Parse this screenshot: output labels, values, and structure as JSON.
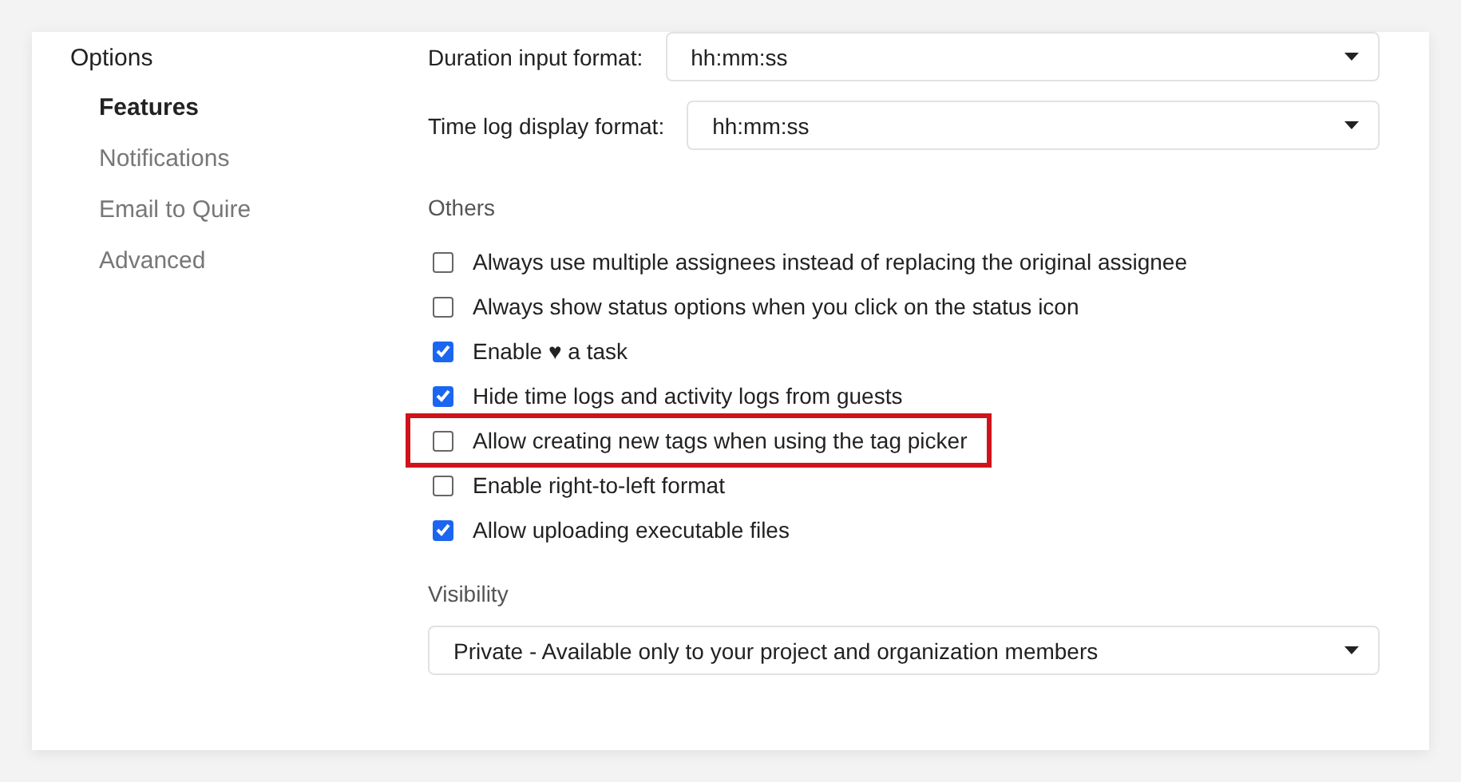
{
  "sidebar": {
    "title": "Options",
    "items": [
      {
        "label": "Features",
        "selected": true
      },
      {
        "label": "Notifications",
        "selected": false
      },
      {
        "label": "Email to Quire",
        "selected": false
      },
      {
        "label": "Advanced",
        "selected": false
      }
    ]
  },
  "formats": [
    {
      "label": "Duration input format:",
      "value": "hh:mm:ss"
    },
    {
      "label": "Time log display format:",
      "value": "hh:mm:ss"
    }
  ],
  "others": {
    "heading": "Others",
    "options": [
      {
        "label": "Always use multiple assignees instead of replacing the original assignee",
        "checked": false,
        "highlighted": false
      },
      {
        "label": "Always show status options when you click on the status icon",
        "checked": false,
        "highlighted": false
      },
      {
        "label": "Enable ♥ a task",
        "checked": true,
        "highlighted": false
      },
      {
        "label": "Hide time logs and activity logs from guests",
        "checked": true,
        "highlighted": false
      },
      {
        "label": "Allow creating new tags when using the tag picker",
        "checked": false,
        "highlighted": true
      },
      {
        "label": "Enable right-to-left format",
        "checked": false,
        "highlighted": false
      },
      {
        "label": "Allow uploading executable files",
        "checked": true,
        "highlighted": false
      }
    ]
  },
  "visibility": {
    "heading": "Visibility",
    "value": "Private - Available only to your project and organization members"
  }
}
